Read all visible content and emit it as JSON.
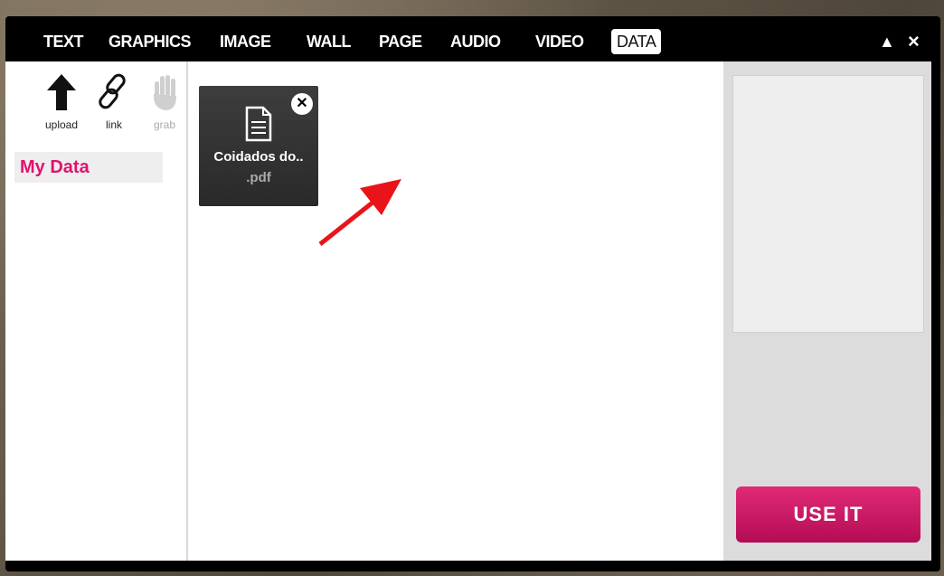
{
  "tabs": {
    "text": "TEXT",
    "graphics": "GRAPHICS",
    "image": "IMAGE",
    "wall": "WALL",
    "page": "PAGE",
    "audio": "AUDIO",
    "video": "VIDEO",
    "data": "DATA",
    "active": "DATA"
  },
  "window_controls": {
    "collapse_icon": "triangle-up-icon",
    "close_icon": "close-icon",
    "collapse_glyph": "▲",
    "close_glyph": "×"
  },
  "sidebar": {
    "tools": {
      "upload": {
        "label": "upload",
        "icon": "upload-arrow-icon"
      },
      "link": {
        "label": "link",
        "icon": "chain-link-icon"
      },
      "grab": {
        "label": "grab",
        "icon": "hand-grab-icon",
        "disabled": true
      }
    },
    "my_data_label": "My Data"
  },
  "files": {
    "file1": {
      "name": "Coidados do..",
      "ext": ".pdf",
      "icon": "document-icon",
      "remove_icon": "close-circle-icon",
      "remove_glyph": "✕"
    }
  },
  "annotation": {
    "icon": "red-arrow-icon"
  },
  "right_panel": {
    "use_button_label": "USE IT"
  },
  "colors": {
    "accent": "#e0126f",
    "button": "#c8185f",
    "window": "#000000"
  }
}
